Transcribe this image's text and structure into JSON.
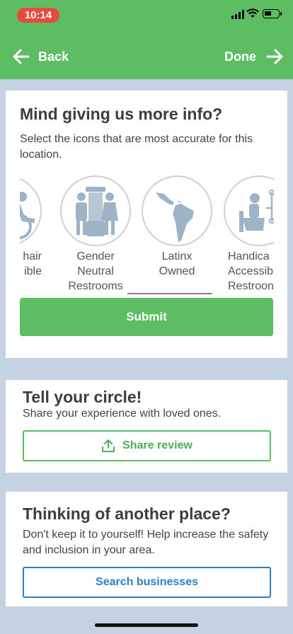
{
  "status_bar": {
    "time": "10:14"
  },
  "nav": {
    "back_label": "Back",
    "done_label": "Done"
  },
  "info_card": {
    "title": "Mind giving us more info?",
    "subtitle": "Select the icons that are most accurate for this location.",
    "tiles": [
      {
        "label": "hair\nible",
        "icon": "wheelchair-accessible-icon"
      },
      {
        "label": "Gender\nNeutral\nRestrooms",
        "icon": "gender-neutral-restroom-icon"
      },
      {
        "label": "Latinx\nOwned",
        "icon": "latin-america-map-icon",
        "selected": true
      },
      {
        "label": "Handica\nAccessib\nRestroon",
        "icon": "handicap-restroom-icon"
      }
    ],
    "submit_label": "Submit"
  },
  "share_card": {
    "title": "Tell your circle!",
    "subtitle": "Share your experience with loved ones.",
    "button_label": "Share review"
  },
  "search_card": {
    "title": "Thinking of another place?",
    "subtitle": "Don't keep it to yourself! Help increase the safety and inclusion in your area.",
    "button_label": "Search businesses"
  },
  "colors": {
    "header_green": "#5cbd63",
    "background": "#c5d2e2",
    "accent_blue": "#2f7fc8",
    "icon_blue": "#9fb3c7"
  }
}
